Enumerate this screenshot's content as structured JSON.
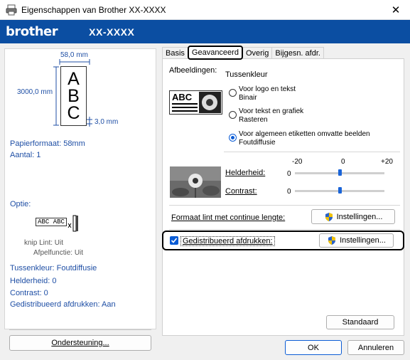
{
  "window": {
    "title": "Eigenschappen van Brother XX-XXXX",
    "close_glyph": "✕"
  },
  "brandbar": {
    "brand": "brother",
    "model": "XX-XXXX"
  },
  "preview": {
    "width_label": "58,0 mm",
    "length_label": "3000,0 mm",
    "margin_label": "3,0 mm",
    "letters": [
      "A",
      "B",
      "C"
    ]
  },
  "summary": {
    "paper_format": "Papierformaat: 58mm",
    "count": "Aantal: 1",
    "option_label": "Optie:",
    "option_sample": "ABC ABC",
    "cut_tape": "knip Lint: Uit",
    "peel_function": "Afpelfunctie: Uit",
    "halftone": "Tussenkleur: Foutdiffusie",
    "brightness": "Helderheid:   0",
    "contrast": "Contrast:   0",
    "distributed": "Gedistribueerd afdrukken: Aan"
  },
  "support_button": "Ondersteuning...",
  "tabs": [
    {
      "label": "Basis"
    },
    {
      "label": "Geavanceerd"
    },
    {
      "label": "Overig"
    },
    {
      "label": "Bijgesn. afdr."
    }
  ],
  "images_section": {
    "heading": "Afbeeldingen:",
    "halftone_heading": "Tussenkleur",
    "sample_text": "ABC",
    "options": [
      {
        "line1": "Voor logo en tekst",
        "line2": "Binair",
        "selected": false
      },
      {
        "line1": "Voor tekst en grafiek",
        "line2": "Rasteren",
        "selected": false
      },
      {
        "line1": "Voor algemeen etiketten omvatte beelden",
        "line2": "Foutdiffusie",
        "selected": true
      }
    ]
  },
  "adjust": {
    "scale_min": "-20",
    "scale_mid": "0",
    "scale_max": "+20",
    "brightness_label": "Helderheid:",
    "brightness_value": "0",
    "brightness_level": 0,
    "contrast_label": "Contrast:",
    "contrast_value": "0",
    "contrast_level": 0
  },
  "continuous": {
    "label": "Formaat lint met continue lengte:",
    "button": "Instellingen..."
  },
  "distributed": {
    "label": "Gedistribueerd afdrukken:",
    "checked": true,
    "button": "Instellingen..."
  },
  "default_button": "Standaard",
  "footer": {
    "ok": "OK",
    "cancel": "Annuleren"
  },
  "colors": {
    "brand_blue": "#0b4ea2",
    "accent": "#0b5cd5",
    "summary_text": "#1f4fa5"
  }
}
